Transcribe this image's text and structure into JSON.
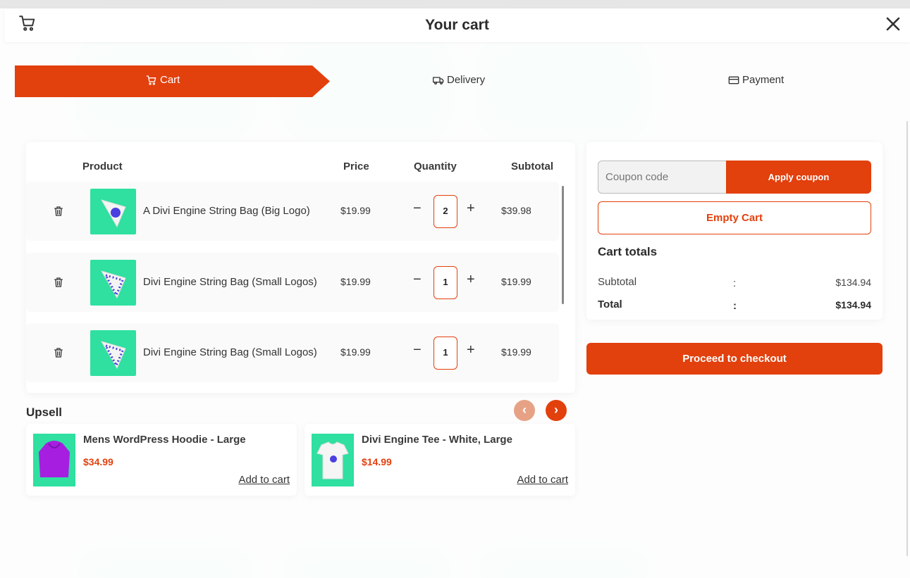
{
  "header": {
    "title": "Your cart"
  },
  "steps": [
    {
      "label": "Cart",
      "icon": "cart-icon",
      "active": true
    },
    {
      "label": "Delivery",
      "icon": "truck-icon",
      "active": false
    },
    {
      "label": "Payment",
      "icon": "card-icon",
      "active": false
    }
  ],
  "cart_table": {
    "headers": {
      "product": "Product",
      "price": "Price",
      "quantity": "Quantity",
      "subtotal": "Subtotal"
    },
    "rows": [
      {
        "name": "A Divi Engine String Bag (Big Logo)",
        "price": "$19.99",
        "qty": "2",
        "subtotal": "$39.98"
      },
      {
        "name": "Divi Engine String Bag (Small Logos)",
        "price": "$19.99",
        "qty": "1",
        "subtotal": "$19.99"
      },
      {
        "name": "Divi Engine String Bag (Small Logos)",
        "price": "$19.99",
        "qty": "1",
        "subtotal": "$19.99"
      }
    ],
    "minus_symbol": "−",
    "plus_symbol": "+"
  },
  "summary": {
    "coupon_placeholder": "Coupon code",
    "apply_label": "Apply coupon",
    "empty_label": "Empty Cart",
    "totals_title": "Cart totals",
    "subtotal_label": "Subtotal",
    "subtotal_value": "$134.94",
    "total_label": "Total",
    "total_value": "$134.94",
    "separator": ":"
  },
  "checkout_label": "Proceed to checkout",
  "upsell": {
    "title": "Upsell",
    "prev_symbol": "‹",
    "next_symbol": "›",
    "items": [
      {
        "name": "Mens WordPress Hoodie - Large",
        "price": "$34.99",
        "add_label": "Add to cart"
      },
      {
        "name": "Divi Engine Tee - White, Large",
        "price": "$14.99",
        "add_label": "Add to cart"
      }
    ]
  },
  "colors": {
    "accent": "#e2400d",
    "accent_light": "#e7a285",
    "product_bg": "#2fe0a0"
  }
}
